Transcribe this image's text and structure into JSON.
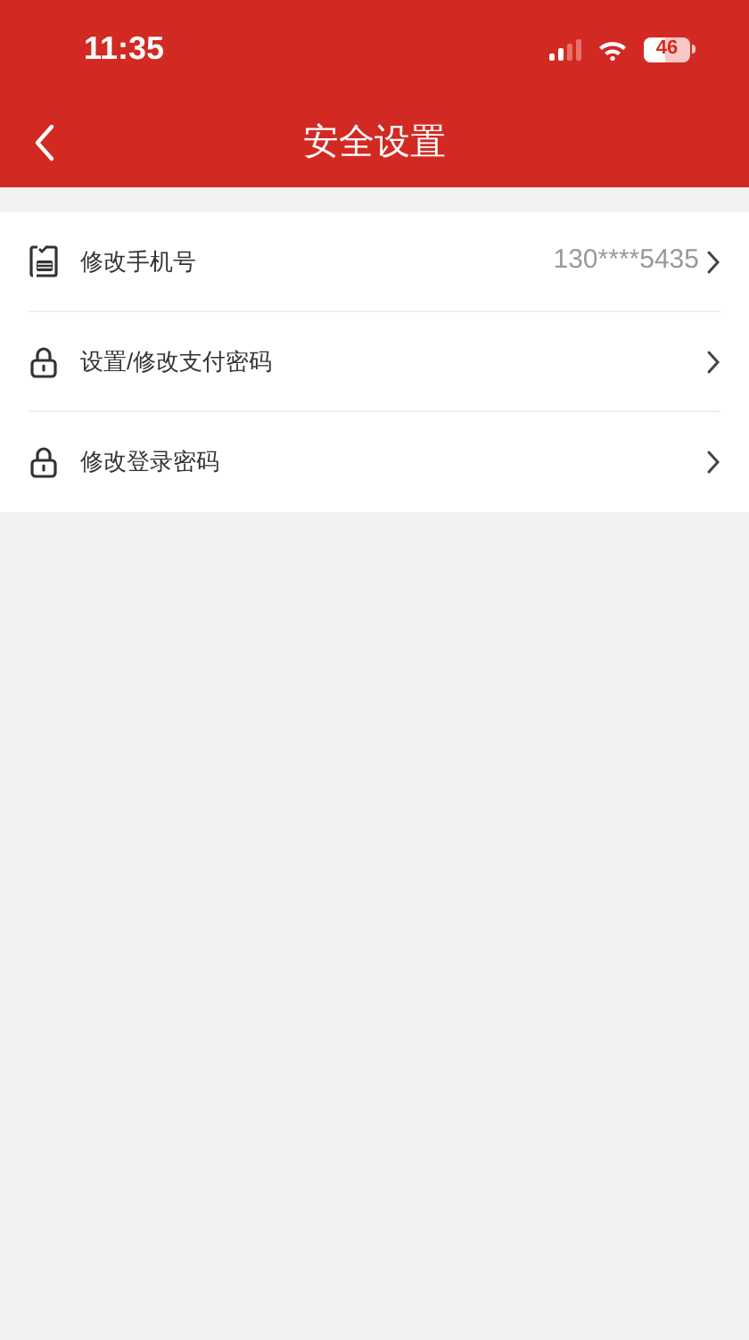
{
  "status_bar": {
    "time": "11:35",
    "battery": "46"
  },
  "nav": {
    "title": "安全设置"
  },
  "rows": [
    {
      "kind": "phone",
      "label": "修改手机号",
      "value": "130****5435"
    },
    {
      "kind": "lock",
      "label": "设置/修改支付密码"
    },
    {
      "kind": "lock",
      "label": "修改登录密码"
    }
  ]
}
